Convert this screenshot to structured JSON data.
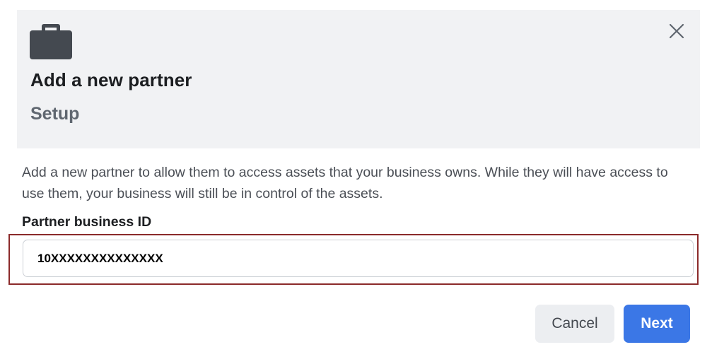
{
  "header": {
    "icon": "briefcase-icon",
    "close_icon": "close-icon",
    "title": "Add a new partner",
    "subtitle": "Setup"
  },
  "body": {
    "description": "Add a new partner to allow them to access assets that your business owns. While they will have access to use them, your business will still be in control of the assets.",
    "field_label": "Partner business ID",
    "field_value": "10XXXXXXXXXXXXXX"
  },
  "footer": {
    "cancel_label": "Cancel",
    "next_label": "Next"
  },
  "colors": {
    "header_bg": "#f1f2f4",
    "primary": "#3b77e6",
    "highlight_border": "#8b2a2a"
  }
}
